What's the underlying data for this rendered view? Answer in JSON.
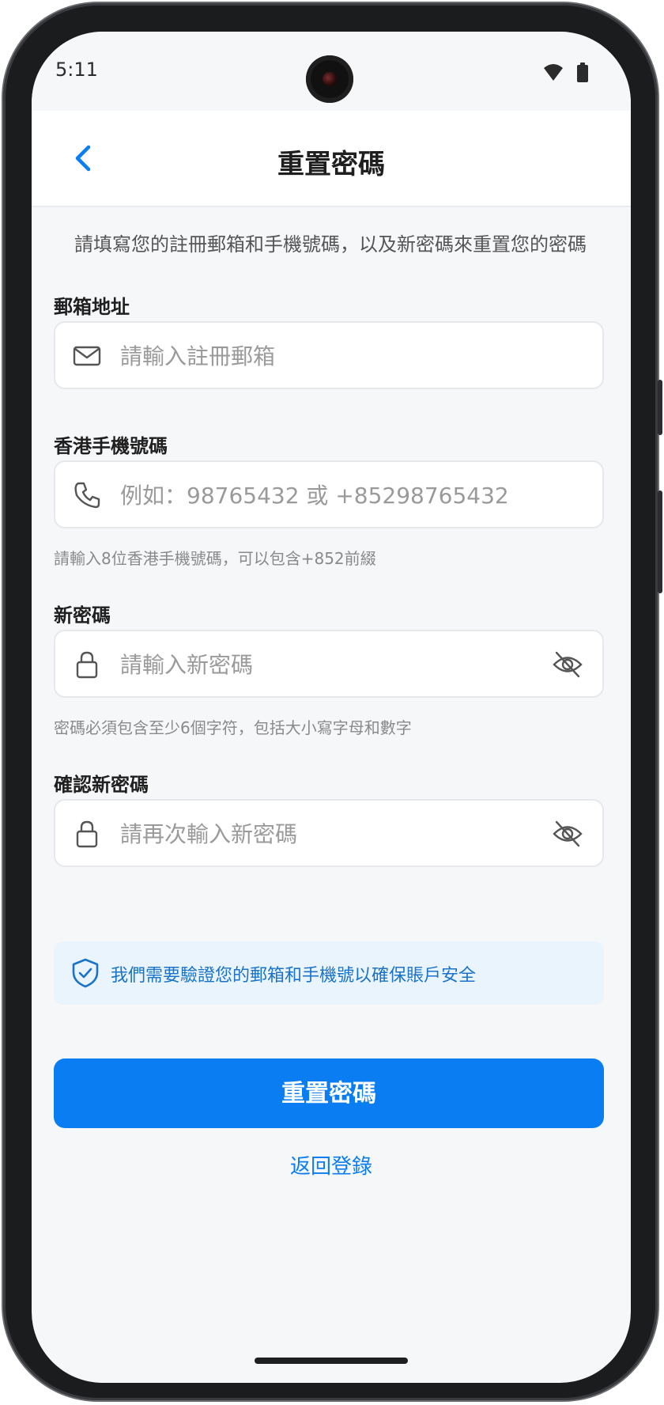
{
  "status_bar": {
    "time": "5:11"
  },
  "header": {
    "title": "重置密碼"
  },
  "description": "請填寫您的註冊郵箱和手機號碼，以及新密碼來重置您的密碼",
  "form": {
    "email": {
      "label": "郵箱地址",
      "placeholder": "請輸入註冊郵箱"
    },
    "phone": {
      "label": "香港手機號碼",
      "placeholder": "例如：98765432 或 +85298765432",
      "hint": "請輸入8位香港手機號碼，可以包含+852前綴"
    },
    "new_password": {
      "label": "新密碼",
      "placeholder": "請輸入新密碼",
      "hint": "密碼必須包含至少6個字符，包括大小寫字母和數字"
    },
    "confirm_password": {
      "label": "確認新密碼",
      "placeholder": "請再次輸入新密碼"
    }
  },
  "notice": {
    "text": "我們需要驗證您的郵箱和手機號以確保賬戶安全"
  },
  "actions": {
    "submit_label": "重置密碼",
    "back_to_login_label": "返回登錄"
  },
  "colors": {
    "accent": "#0a7df2",
    "notice_bg": "#eaf4fc",
    "notice_text": "#1a73c9"
  }
}
